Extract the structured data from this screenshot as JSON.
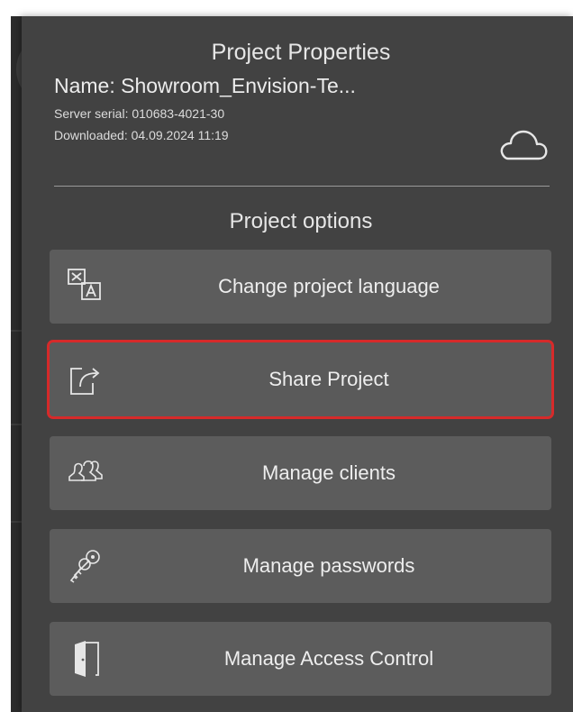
{
  "panel": {
    "title": "Project Properties",
    "name_line": "Name: Showroom_Envision-Te...",
    "server_line": "Server serial: 010683-4021-30",
    "downloaded_line": "Downloaded: 04.09.2024 11:19",
    "cloud_icon": "cloud-icon"
  },
  "options": {
    "title": "Project options",
    "items": [
      {
        "label": "Change project language",
        "icon": "translate-icon"
      },
      {
        "label": "Share Project",
        "icon": "share-icon",
        "highlighted": true
      },
      {
        "label": "Manage clients",
        "icon": "users-icon"
      },
      {
        "label": "Manage passwords",
        "icon": "keys-icon"
      },
      {
        "label": "Manage Access Control",
        "icon": "door-icon"
      }
    ]
  },
  "background": {
    "glyph": "I"
  },
  "colors": {
    "panel_bg": "#424242",
    "button_bg": "#5c5c5c",
    "highlight": "#d62a2a",
    "text": "#eeeeee"
  }
}
